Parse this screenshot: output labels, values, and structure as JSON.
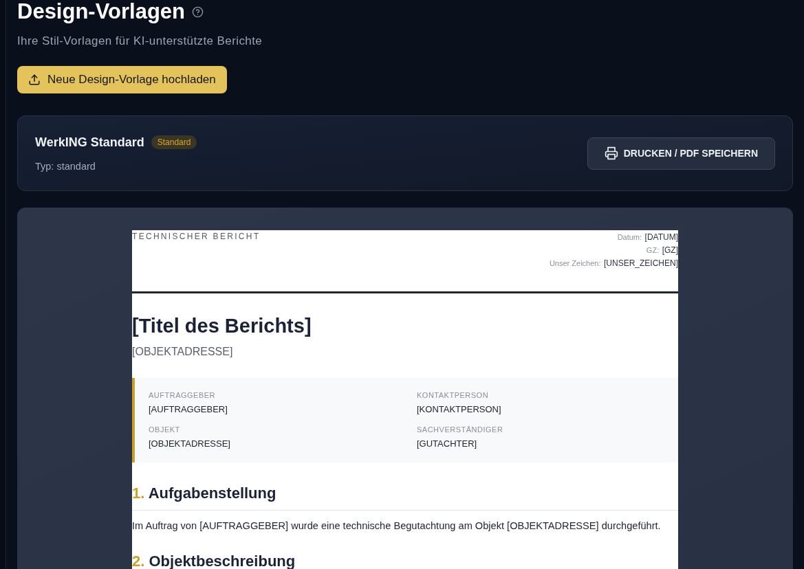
{
  "header": {
    "title": "Design-Vorlagen",
    "subtitle": "Ihre Stil-Vorlagen für KI-unterstützte Berichte",
    "upload_button": "Neue Design-Vorlage hochladen"
  },
  "template_card": {
    "name": "WerkING Standard",
    "badge": "Standard",
    "type": "Typ: standard",
    "print_button": "DRUCKEN / PDF SPEICHERN"
  },
  "preview": {
    "doc_label": "TECHNISCHER BERICHT",
    "meta": [
      {
        "label": "Datum:",
        "value": "[DATUM]"
      },
      {
        "label": "GZ:",
        "value": "[GZ]"
      },
      {
        "label": "Unser Zeichen:",
        "value": "[UNSER_ZEICHEN]"
      }
    ],
    "title": "[Titel des Berichts]",
    "address": "[OBJEKTADRESSE]",
    "info": [
      {
        "label": "AUFTRAGGEBER",
        "value": "[AUFTRAGGEBER]"
      },
      {
        "label": "KONTAKTPERSON",
        "value": "[KONTAKTPERSON]"
      },
      {
        "label": "OBJEKT",
        "value": "[OBJEKTADRESSE]"
      },
      {
        "label": "SACHVERSTÄNDIGER",
        "value": "[GUTACHTER]"
      }
    ],
    "sections": [
      {
        "number": "1.",
        "heading": "Aufgabenstellung",
        "text": "Im Auftrag von [AUFTRAGGEBER] wurde eine technische Begutachtung am Objekt [OBJEKTADRESSE] durchgeführt."
      },
      {
        "number": "2.",
        "heading": "Objektbeschreibung"
      }
    ]
  }
}
